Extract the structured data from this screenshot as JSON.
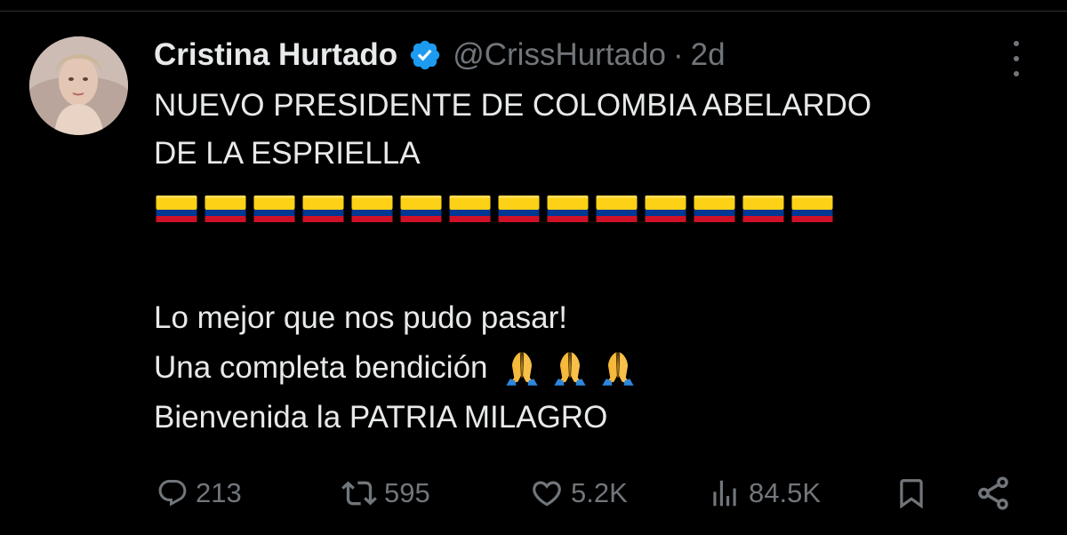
{
  "tweet": {
    "author": {
      "display_name": "Cristina Hurtado",
      "handle": "@CrissHurtado",
      "separator": "·",
      "time": "2d",
      "verified": true
    },
    "text_lines": [
      "NUEVO PRESIDENTE DE COLOMBIA ABELARDO",
      "DE LA ESPRIELLA"
    ],
    "flag_emoji_count": 14,
    "flag_colors": {
      "yellow": "#FCD116",
      "blue": "#003893",
      "red": "#CE1126"
    },
    "body_lines": [
      "Lo mejor que nos pudo pasar!",
      "Una completa bendición",
      "Bienvenida la PATRIA MILAGRO"
    ],
    "pray_emoji_count": 3,
    "metrics": {
      "replies": "213",
      "retweets": "595",
      "likes": "5.2K",
      "views": "84.5K"
    },
    "icons": {
      "reply": "reply-icon",
      "retweet": "retweet-icon",
      "like": "heart-icon",
      "views": "views-icon",
      "bookmark": "bookmark-icon",
      "share": "share-icon",
      "more": "more-icon",
      "verified": "verified-badge-icon"
    },
    "colors": {
      "background": "#000000",
      "text": "#e7e9ea",
      "muted": "#71767b",
      "verified": "#1d9bf0"
    }
  }
}
